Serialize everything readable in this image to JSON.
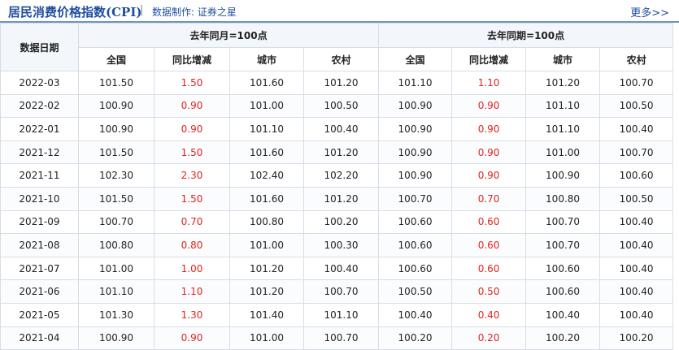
{
  "header": {
    "title": "居民消费价格指数(CPI)",
    "separator": "|",
    "source": "数据制作: 证券之星",
    "more": "更多>>"
  },
  "table": {
    "date_header": "数据日期",
    "group1": "去年同月=100点",
    "group2": "去年同期=100点",
    "subheaders": [
      "全国",
      "同比增减",
      "城市",
      "农村",
      "全国",
      "同比增减",
      "城市",
      "农村"
    ],
    "rows": [
      [
        "2022-03",
        "101.50",
        "1.50",
        "101.60",
        "101.20",
        "101.10",
        "1.10",
        "101.20",
        "100.70"
      ],
      [
        "2022-02",
        "100.90",
        "0.90",
        "101.00",
        "100.50",
        "100.90",
        "0.90",
        "101.10",
        "100.50"
      ],
      [
        "2022-01",
        "100.90",
        "0.90",
        "101.10",
        "100.40",
        "100.90",
        "0.90",
        "101.10",
        "100.40"
      ],
      [
        "2021-12",
        "101.50",
        "1.50",
        "101.60",
        "101.20",
        "100.90",
        "0.90",
        "101.00",
        "100.70"
      ],
      [
        "2021-11",
        "102.30",
        "2.30",
        "102.40",
        "102.20",
        "100.90",
        "0.90",
        "100.90",
        "100.60"
      ],
      [
        "2021-10",
        "101.50",
        "1.50",
        "101.60",
        "101.20",
        "100.70",
        "0.70",
        "100.80",
        "100.50"
      ],
      [
        "2021-09",
        "100.70",
        "0.70",
        "100.80",
        "100.20",
        "100.60",
        "0.60",
        "100.70",
        "100.40"
      ],
      [
        "2021-08",
        "100.80",
        "0.80",
        "101.00",
        "100.30",
        "100.60",
        "0.60",
        "100.70",
        "100.40"
      ],
      [
        "2021-07",
        "101.00",
        "1.00",
        "101.20",
        "100.40",
        "100.60",
        "0.60",
        "100.60",
        "100.40"
      ],
      [
        "2021-06",
        "101.10",
        "1.10",
        "101.20",
        "100.70",
        "100.50",
        "0.50",
        "100.60",
        "100.40"
      ],
      [
        "2021-05",
        "101.30",
        "1.30",
        "101.40",
        "101.10",
        "100.40",
        "0.40",
        "100.40",
        "100.40"
      ],
      [
        "2021-04",
        "100.90",
        "0.90",
        "101.00",
        "100.70",
        "100.20",
        "0.20",
        "100.20",
        "100.20"
      ]
    ]
  },
  "colors": {
    "accent": "#1f4e9e",
    "positive_change": "#e0251e",
    "border": "#d7dde6"
  }
}
